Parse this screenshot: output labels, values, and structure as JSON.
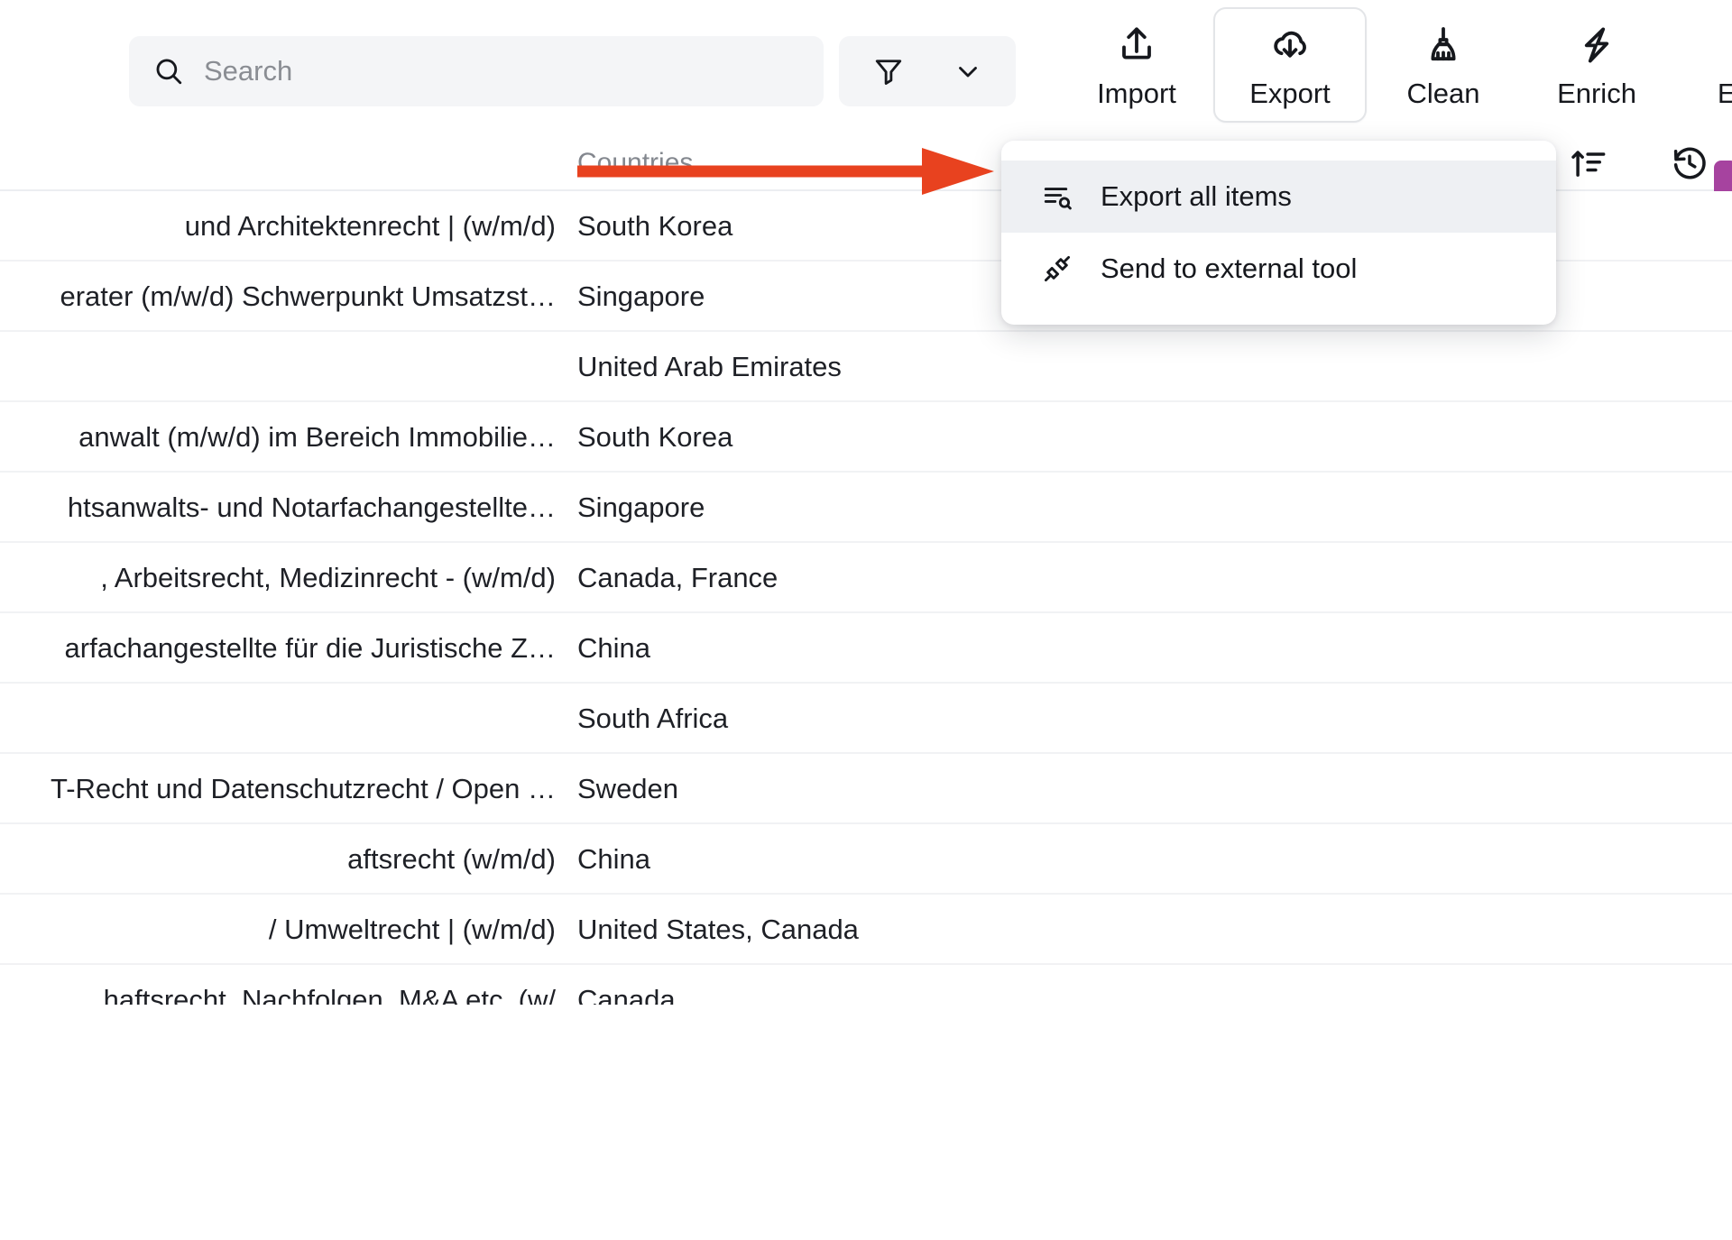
{
  "colors": {
    "accent_purple": "#a6439f",
    "annotation_red": "#e8421f",
    "menu_highlight": "#eef0f3",
    "field_bg": "#f4f5f7",
    "text_primary": "#1e2026",
    "text_muted": "#83878e"
  },
  "toolbar": {
    "search": {
      "value": "",
      "placeholder": "Search",
      "icon": "search-icon"
    },
    "filter": {
      "icon": "filter-icon",
      "chevron_icon": "chevron-down-icon"
    },
    "buttons": [
      {
        "label": "Import",
        "icon": "upload-icon",
        "active": false
      },
      {
        "label": "Export",
        "icon": "cloud-download-icon",
        "active": true
      },
      {
        "label": "Clean",
        "icon": "broom-icon",
        "active": false
      },
      {
        "label": "Enrich",
        "icon": "lightning-bolt-icon",
        "active": false
      },
      {
        "label": "Extra",
        "icon": "extract-scan-icon",
        "active": false
      }
    ]
  },
  "export_menu": {
    "items": [
      {
        "label": "Export all items",
        "icon": "list-search-icon",
        "highlighted": true
      },
      {
        "label": "Send to external tool",
        "icon": "plug-connect-icon",
        "highlighted": false
      }
    ]
  },
  "table": {
    "headers": {
      "title": "",
      "countries": "Countries"
    },
    "header_icons": [
      {
        "name": "sort-ascending-icon"
      },
      {
        "name": "history-icon"
      }
    ],
    "rows": [
      {
        "title": "und Architektenrecht | (w/m/d)",
        "countries": "South Korea"
      },
      {
        "title": "erater (m/w/d) Schwerpunkt Umsatzst…",
        "countries": "Singapore"
      },
      {
        "title": "",
        "countries": "United Arab Emirates"
      },
      {
        "title": "anwalt (m/w/d) im Bereich Immobilie…",
        "countries": "South Korea"
      },
      {
        "title": "htsanwalts- und Notarfachangestellte…",
        "countries": "Singapore"
      },
      {
        "title": ", Arbeitsrecht, Medizinrecht - (w/m/d)",
        "countries": "Canada, France"
      },
      {
        "title": "arfachangestellte für die Juristische Z…",
        "countries": "China"
      },
      {
        "title": "",
        "countries": "South Africa"
      },
      {
        "title": "T-Recht und Datenschutzrecht / Open …",
        "countries": "Sweden"
      },
      {
        "title": "aftsrecht (w/m/d)",
        "countries": "China"
      },
      {
        "title": "/ Umweltrecht | (w/m/d)",
        "countries": "United States, Canada"
      },
      {
        "title": "haftsrecht, Nachfolgen, M&A etc. (w/",
        "countries": "Canada"
      }
    ]
  },
  "annotation": {
    "type": "arrow",
    "direction": "right",
    "points_to": "Export all items"
  }
}
